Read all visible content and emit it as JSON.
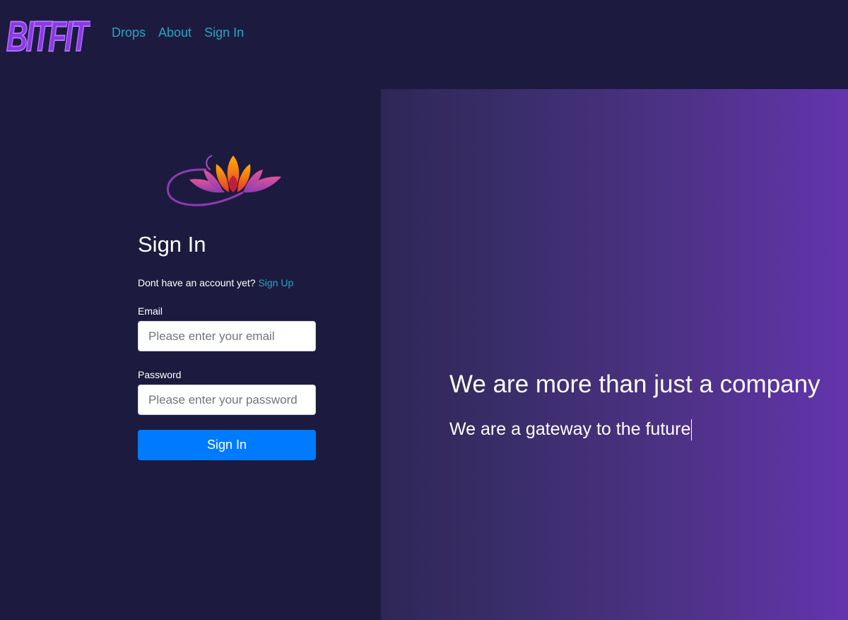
{
  "brand": {
    "logo_text": "BITFIT",
    "logo_color": "#8a3ae0"
  },
  "nav": {
    "items": [
      {
        "label": "Drops"
      },
      {
        "label": "About"
      },
      {
        "label": "Sign In"
      }
    ],
    "link_color": "#26a4c4"
  },
  "signin_form": {
    "title": "Sign In",
    "no_account_text": "Dont have an account yet?",
    "signup_link": "Sign Up",
    "email": {
      "label": "Email",
      "placeholder": "Please enter your email",
      "value": ""
    },
    "password": {
      "label": "Password",
      "placeholder": "Please enter your password",
      "value": ""
    },
    "submit_label": "Sign In",
    "submit_color": "#007bff"
  },
  "hero": {
    "headline": "We are more than just a company",
    "subheadline": "We are a gateway to the future"
  },
  "colors": {
    "background": "#1c1b3f",
    "gradient_start": "#2e2756",
    "gradient_end": "#6335ad"
  }
}
